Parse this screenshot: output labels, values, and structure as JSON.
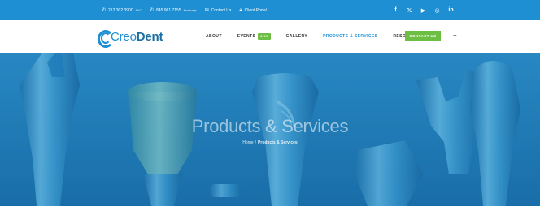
{
  "topbar": {
    "phone1": "212.302.3900",
    "phone1_tag": "NYC",
    "phone2": "845.961.7155",
    "phone2_tag": "Newburgh",
    "contact_us": "Contact Us",
    "client_portal": "Client Portal",
    "social": [
      {
        "icon": "facebook-icon",
        "glyph": "f"
      },
      {
        "icon": "twitter-icon",
        "glyph": "𝕏"
      },
      {
        "icon": "youtube-icon",
        "glyph": "▶"
      },
      {
        "icon": "instagram-icon",
        "glyph": "◎"
      },
      {
        "icon": "linkedin-icon",
        "glyph": "in"
      }
    ]
  },
  "header": {
    "logo_light": "Creo",
    "logo_bold": "Dent",
    "logo_dot": ".",
    "nav": [
      {
        "label": "ABOUT"
      },
      {
        "label": "EVENTS",
        "badge": "2019"
      },
      {
        "label": "GALLERY"
      },
      {
        "label": "PRODUCTS & SERVICES",
        "active": true
      },
      {
        "label": "RESOURCES"
      }
    ],
    "contact_button": "CONTACT US",
    "search_glyph": "+"
  },
  "hero": {
    "title": "Products & Services",
    "breadcrumb_home": "Home",
    "breadcrumb_sep": "/",
    "breadcrumb_current": "Products & Services"
  },
  "colors": {
    "brand_blue": "#1d8fd2",
    "accent_green": "#6cbf43",
    "hero_bg": "#1e7bb8"
  }
}
